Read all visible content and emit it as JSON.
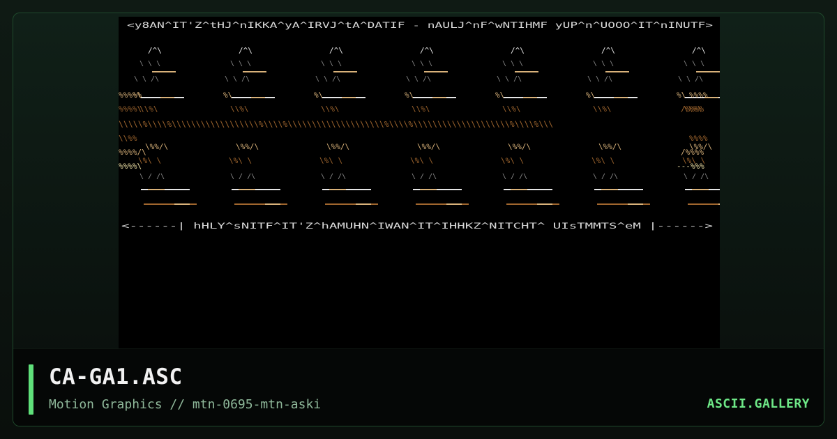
{
  "artwork": {
    "header_line": "<y8AN^IT'Z^tHJ^nIKKA^yA^IRVJ^tA^DATIF - nAULJ^nF^wNTIHMF yUP^n^UOOO^IT^nINUTF>",
    "footer_line": "<------| hHLY^sNITF^IT'Z^hAMUHN^IWAN^IT^IHHKZ^NITCHT^  UIsTMMTS^eM   |------>",
    "palette": {
      "background": "#000000",
      "white": "#e6e6e6",
      "brown": "#a0662e",
      "tan": "#d9b27a",
      "cream": "#f2e4a8",
      "grey": "#8c8c8c",
      "cyan": "#5fb8c8"
    }
  },
  "footer": {
    "title": "CA-GA1.ASC",
    "subtitle": "Motion Graphics // mtn-0695-mtn-aski",
    "brand": "ASCII.GALLERY"
  },
  "colors": {
    "accent": "#5fe07a",
    "brand": "#6ee887"
  }
}
